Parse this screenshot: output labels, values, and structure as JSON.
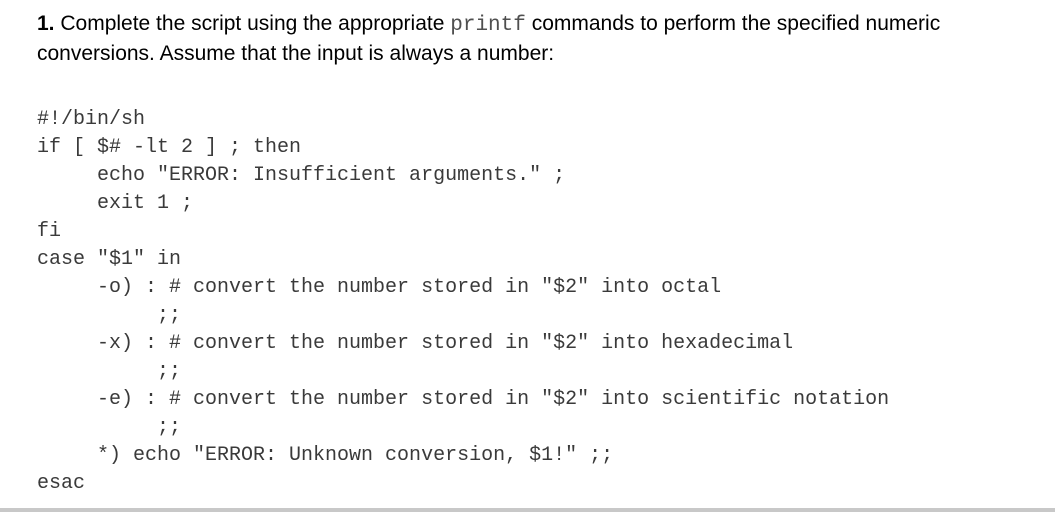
{
  "question": {
    "number": "1.",
    "text_before": " Complete the script using the appropriate ",
    "inline_code": "printf",
    "text_after": " commands to perform the specified numeric conversions. Assume that the input is always a number:"
  },
  "code_lines": [
    "#!/bin/sh",
    "if [ $# -lt 2 ] ; then",
    "     echo \"ERROR: Insufficient arguments.\" ;",
    "     exit 1 ;",
    "fi",
    "case \"$1\" in",
    "     -o) : # convert the number stored in \"$2\" into octal",
    "          ;;",
    "     -x) : # convert the number stored in \"$2\" into hexadecimal",
    "          ;;",
    "     -e) : # convert the number stored in \"$2\" into scientific notation",
    "          ;;",
    "     *) echo \"ERROR: Unknown conversion, $1!\" ;;",
    "esac"
  ]
}
